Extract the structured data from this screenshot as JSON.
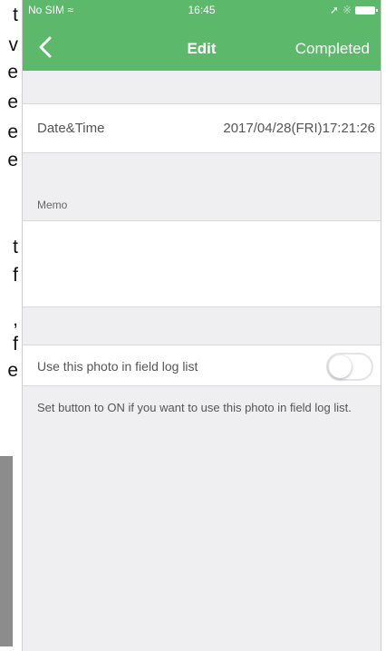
{
  "side_fragments": [
    "t",
    "v",
    "e",
    "e",
    "e",
    "e",
    "t",
    "f",
    ",",
    "f",
    "e"
  ],
  "status_bar": {
    "carrier": "No SIM",
    "time": "16:45"
  },
  "nav": {
    "title": "Edit",
    "completed_label": "Completed"
  },
  "datetime": {
    "label": "Date&Time",
    "value": "2017/04/28(FRI)17:21:26"
  },
  "memo": {
    "label": "Memo",
    "value": ""
  },
  "field_log": {
    "label": "Use this photo in field log list",
    "enabled": false,
    "hint": "Set button to ON if you want to use this photo in field log list."
  },
  "colors": {
    "nav_green": "#5cb86a",
    "background": "#efeff1"
  }
}
